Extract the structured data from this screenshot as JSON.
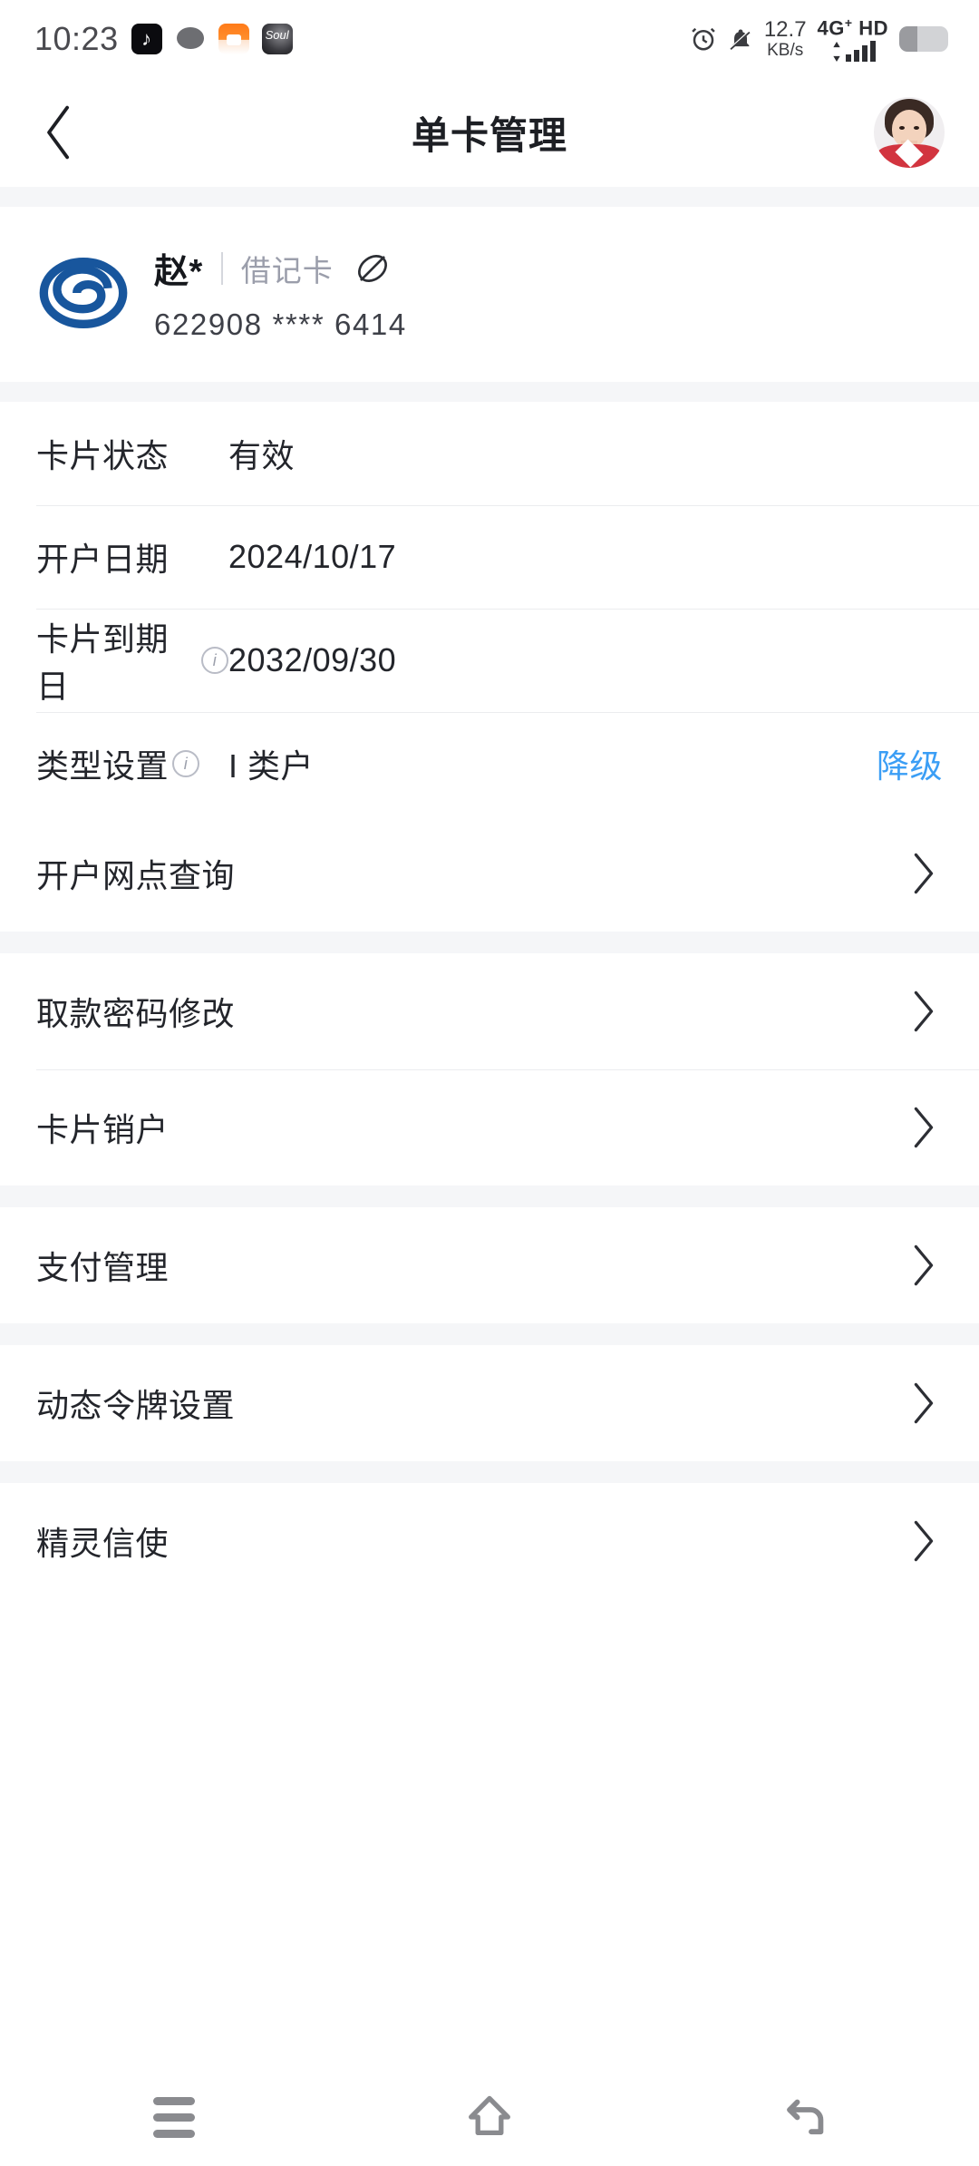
{
  "status_bar": {
    "time": "10:23",
    "app_icons": [
      "tiktok-icon",
      "chat-bubble-icon",
      "fox-app-icon",
      "soul-app-icon"
    ],
    "alarm_icon": "alarm-clock-icon",
    "mute_icon": "bell-muted-icon",
    "network_speed_value": "12.7",
    "network_speed_unit": "KB/s",
    "signal_label": "4G",
    "signal_superscript": "+",
    "hd_label": "HD",
    "battery_icon": "battery-icon"
  },
  "app_bar": {
    "back_icon": "back-chevron-icon",
    "title": "单卡管理",
    "avatar_icon": "user-avatar"
  },
  "card": {
    "bank_logo_icon": "bank-spiral-logo",
    "owner_name": "赵*",
    "card_type": "借记卡",
    "eye_icon": "eye-hidden-icon",
    "card_number": "622908 **** 6414"
  },
  "info_rows": [
    {
      "label": "卡片状态",
      "has_info_icon": false,
      "value": "有效",
      "action": ""
    },
    {
      "label": "开户日期",
      "has_info_icon": false,
      "value": "2024/10/17",
      "action": ""
    },
    {
      "label": "卡片到期日",
      "has_info_icon": true,
      "value": "2032/09/30",
      "action": ""
    },
    {
      "label": "类型设置",
      "has_info_icon": true,
      "value": "I 类户",
      "action": "降级"
    }
  ],
  "nav_groups": [
    {
      "items": [
        {
          "label": "开户网点查询"
        }
      ]
    },
    {
      "items": [
        {
          "label": "取款密码修改"
        },
        {
          "label": "卡片销户"
        }
      ]
    },
    {
      "items": [
        {
          "label": "支付管理"
        }
      ]
    },
    {
      "items": [
        {
          "label": "动态令牌设置"
        }
      ]
    },
    {
      "items": [
        {
          "label": "精灵信使"
        }
      ]
    }
  ],
  "system_nav": {
    "recents_icon": "recents-menu-icon",
    "home_icon": "home-icon",
    "back_icon": "back-arrow-icon"
  },
  "colors": {
    "accent_blue": "#3b9ef5",
    "bank_blue": "#18569d",
    "text_primary": "#23252b",
    "text_muted": "#9b9eab",
    "divider": "#ebecef",
    "page_bg": "#f5f6f8"
  }
}
